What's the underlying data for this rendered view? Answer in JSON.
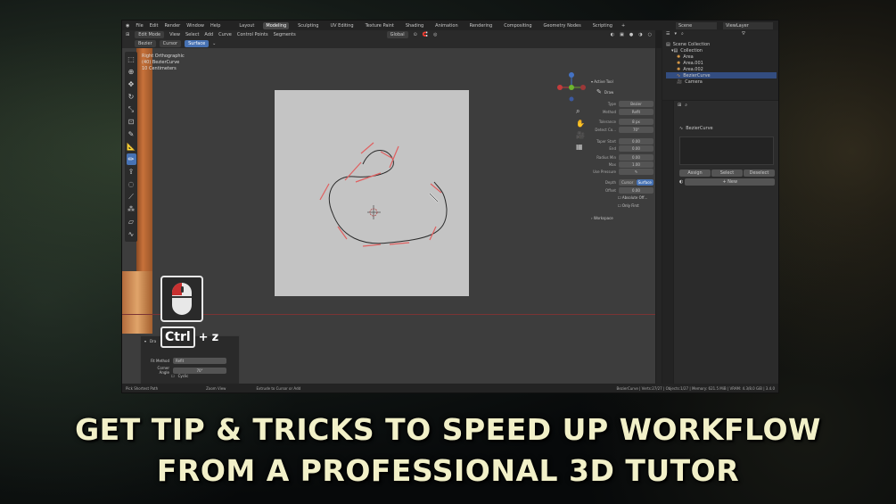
{
  "menu": {
    "items": [
      "File",
      "Edit",
      "Render",
      "Window",
      "Help"
    ],
    "workspaces": [
      "Layout",
      "Modeling",
      "Sculpting",
      "UV Editing",
      "Texture Paint",
      "Shading",
      "Animation",
      "Rendering",
      "Compositing",
      "Geometry Nodes",
      "Scripting"
    ],
    "active_workspace": "Modeling",
    "scene": "Scene",
    "view_layer": "ViewLayer"
  },
  "header": {
    "mode": "Edit Mode",
    "menus": [
      "View",
      "Select",
      "Add",
      "Curve",
      "Control Points",
      "Segments"
    ],
    "transform_orientation": "Global",
    "tool_settings": {
      "type": "Bezier",
      "cursor": "Cursor",
      "surface": "Surface"
    }
  },
  "viewport": {
    "info_lines": [
      "Right Orthographic",
      "(40) BezierCurve",
      "10 Centimeters"
    ]
  },
  "npanel": {
    "section": "Active Tool",
    "tool_name": "Draw",
    "rows": [
      {
        "label": "Type",
        "value": "Bezier"
      },
      {
        "label": "Method",
        "value": "Refit"
      },
      {
        "label": "Tolerance",
        "value": "8 px"
      },
      {
        "label": "Detect Co...",
        "value": "70°"
      },
      {
        "label": "Taper Start",
        "value": "0.00"
      },
      {
        "label": "End",
        "value": "0.00"
      },
      {
        "label": "Radius Min",
        "value": "0.00"
      },
      {
        "label": "Max",
        "value": "1.00"
      },
      {
        "label": "Use Pressure",
        "value": ""
      }
    ],
    "depth_label": "Depth",
    "depth_options": [
      "Cursor",
      "Surface"
    ],
    "offset_label": "Offset",
    "offset_value": "0.00",
    "absolute_offset": "Absolute Off...",
    "only_first": "Only First",
    "workspace": "Workspace"
  },
  "redo_panel": {
    "title": "Dra",
    "fit_method_label": "Fit Method",
    "fit_method_value": "Refit",
    "corner_angle_label": "Corner Angle",
    "corner_angle_value": "70°",
    "cyclic_label": "Cyclic"
  },
  "overlay": {
    "ctrl_key": "Ctrl",
    "plus": "+",
    "z_key": "z"
  },
  "outliner": {
    "header": "Scene Collection",
    "items": [
      {
        "name": "Collection"
      },
      {
        "name": "Area"
      },
      {
        "name": "Area.001"
      },
      {
        "name": "Area.002"
      },
      {
        "name": "BezierCurve"
      },
      {
        "name": "Camera"
      }
    ],
    "selected": "BezierCurve"
  },
  "properties": {
    "object_name": "BezierCurve",
    "buttons": [
      "Assign",
      "Select",
      "Deselect"
    ],
    "new_label": "New"
  },
  "statusbar": {
    "left": "Pick Shortest Path",
    "mid": "Zoom View",
    "mid2": "Extrude to Cursor or Add",
    "right": "BezierCurve | Verts:27/27 | Objects:1/27 | Memory: 621.5 MiB | VRAM: 4.3/8.0 GiB | 3.4.0"
  },
  "headline": {
    "line1": "GET TIP & TRICKS TO SPEED UP WORKFLOW",
    "line2": "FROM A PROFESSIONAL 3D TUTOR"
  },
  "colors": {
    "accent": "#4772b3",
    "handle_red": "#e06060",
    "curve": "#2a2a2a",
    "headline": "#f2f0c8"
  }
}
